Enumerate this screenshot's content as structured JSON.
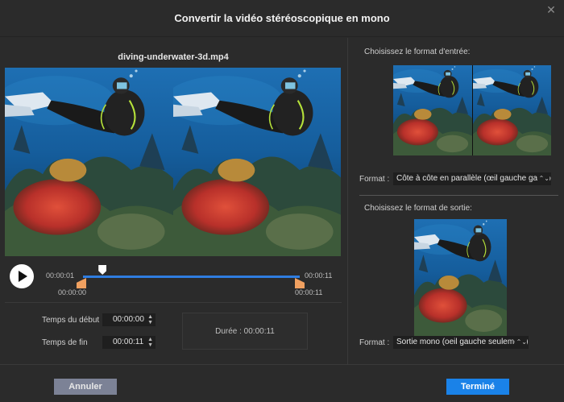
{
  "window": {
    "title": "Convertir la vidéo stéréoscopique en mono",
    "close_icon": "close-icon"
  },
  "player": {
    "filename": "diving-underwater-3d.mp4",
    "play_icon": "play-icon",
    "current_time": "00:00:01",
    "end_time": "00:00:11",
    "range_start_label": "00:00:00",
    "range_end_label": "00:00:11",
    "playhead_fraction": 0.09
  },
  "trim": {
    "start_label": "Temps du début",
    "start_value": "00:00:00",
    "end_label": "Temps de fin",
    "end_value": "00:00:11",
    "duration_text": "Durée : 00:00:11"
  },
  "input_format": {
    "heading": "Choisissez le format d'entrée:",
    "format_label": "Format :",
    "selected": "Côte à côte en parallèle (œil gauche gauche)"
  },
  "output_format": {
    "heading": "Choisissez le format de sortie:",
    "format_label": "Format :",
    "selected": "Sortie mono (oeil gauche seulement)"
  },
  "footer": {
    "cancel_label": "Annuler",
    "done_label": "Terminé"
  },
  "colors": {
    "accent": "#1a82e8",
    "track": "#2f7de0",
    "handle": "#f0a060",
    "cancel_bg": "#7c8296"
  }
}
